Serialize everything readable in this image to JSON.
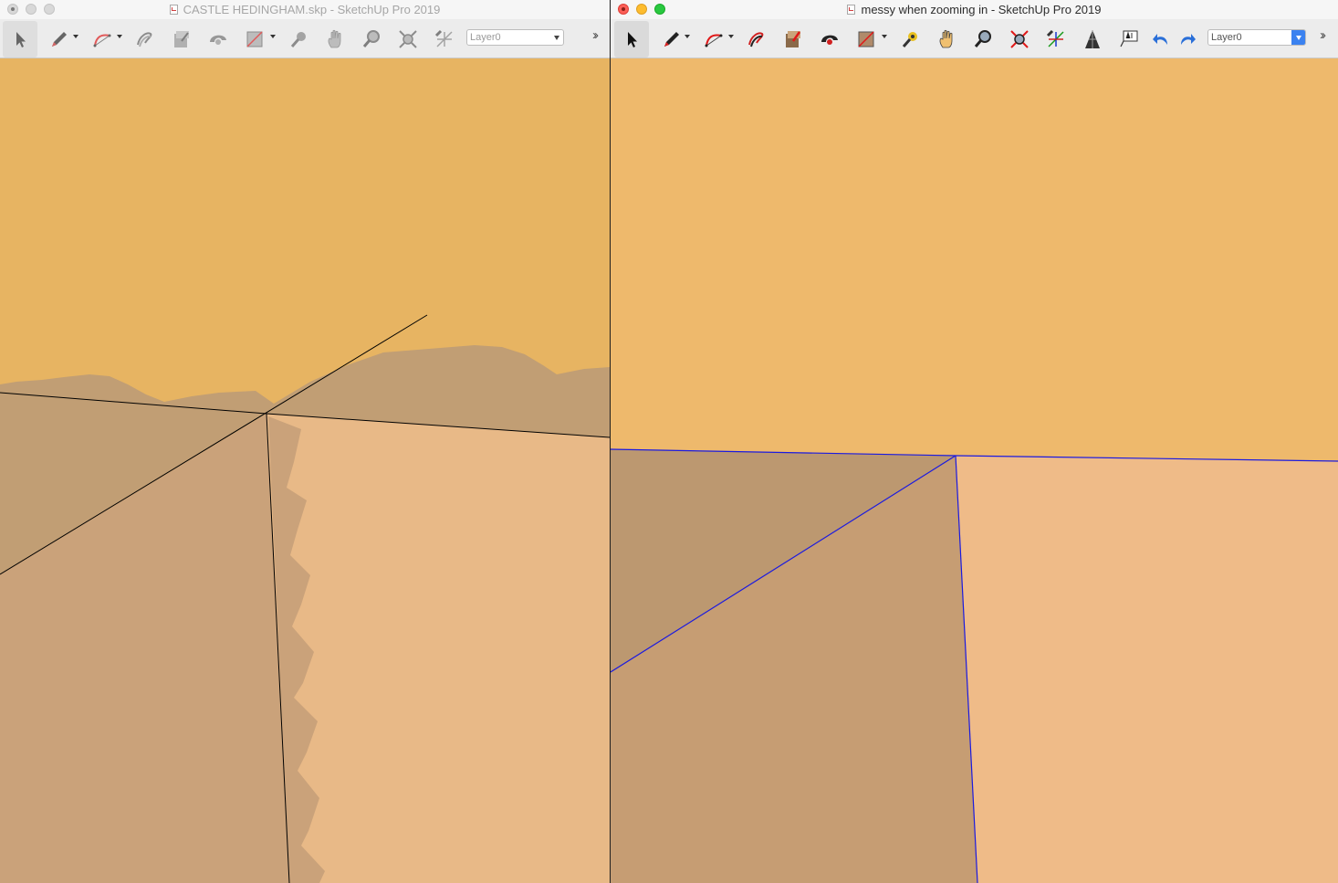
{
  "windows": {
    "left": {
      "title": "CASTLE HEDINGHAM.skp - SketchUp Pro 2019",
      "layer": "Layer0",
      "state": "inactive"
    },
    "right": {
      "title": "messy when zooming in - SketchUp Pro 2019",
      "layer": "Layer0",
      "state": "active"
    }
  },
  "toolbar": {
    "left_tools": [
      "select-icon",
      "pencil-icon",
      "arc-icon",
      "freehand-icon",
      "pushpull-icon",
      "followme-icon",
      "rectangle-icon",
      "tape-measure-icon",
      "pan-icon",
      "zoom-icon",
      "zoom-extents-icon",
      "axes-icon"
    ],
    "right_tools": [
      "select-icon",
      "pencil-icon",
      "arc-icon",
      "freehand-icon",
      "pushpull-icon",
      "followme-icon",
      "rectangle-icon",
      "tape-measure-icon",
      "pan-icon",
      "zoom-icon",
      "zoom-extents-icon",
      "axes-icon",
      "perspective-icon",
      "text-icon",
      "undo-icon",
      "redo-icon"
    ]
  },
  "colors": {
    "sky_left": "#e7b462",
    "face_dark_left": "#c19e74",
    "face_mid_left": "#caa27a",
    "face_light_left": "#e8b987",
    "sky_right": "#eeb96c",
    "face_dark_right": "#bc9870",
    "face_mid_right": "#c69d73",
    "face_light_right": "#efbb88",
    "edge_left": "#000000",
    "edge_right": "#1a1ae0"
  }
}
